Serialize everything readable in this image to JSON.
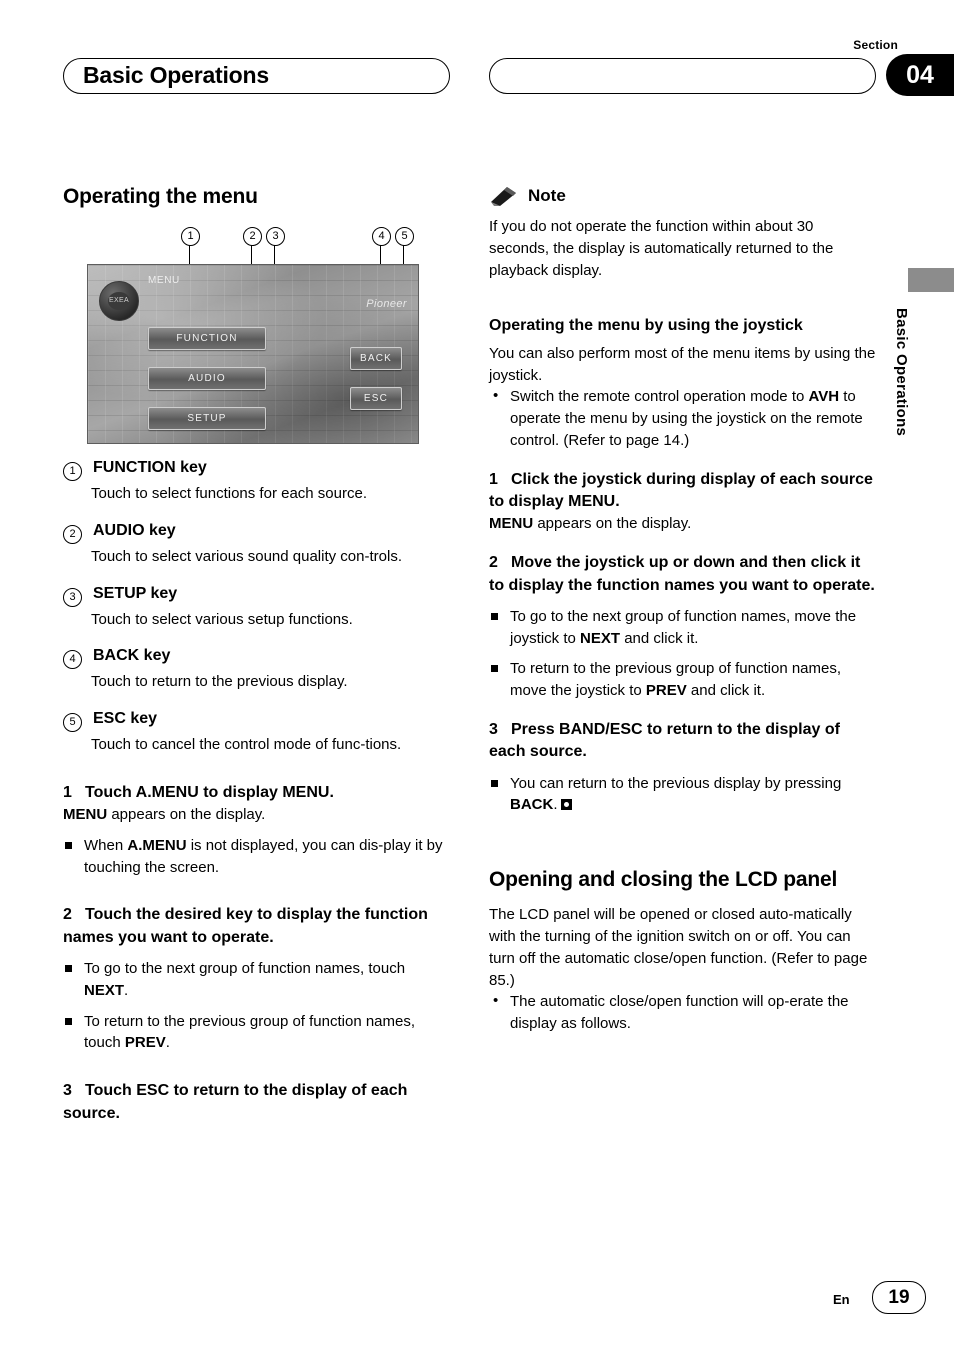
{
  "header": {
    "section_label": "Section",
    "section_number": "04",
    "title": "Basic Operations"
  },
  "side_tab": {
    "label": "Basic Operations"
  },
  "left": {
    "section_title": "Operating the menu",
    "figure": {
      "callouts": [
        "1",
        "2",
        "3",
        "4",
        "5"
      ],
      "device": {
        "knob_label": "EXEA",
        "menu_tag": "MENU",
        "brand": "Pioneer",
        "buttons": [
          "FUNCTION",
          "AUDIO",
          "SETUP",
          "BACK",
          "ESC"
        ]
      }
    },
    "keys": [
      {
        "num": "1",
        "label": "FUNCTION key",
        "desc": "Touch to select functions for each source."
      },
      {
        "num": "2",
        "label": "AUDIO key",
        "desc": "Touch to select various sound quality con-trols."
      },
      {
        "num": "3",
        "label": "SETUP key",
        "desc": "Touch to select various setup functions."
      },
      {
        "num": "4",
        "label": "BACK key",
        "desc": "Touch to return to the previous display."
      },
      {
        "num": "5",
        "label": "ESC key",
        "desc": "Touch to cancel the control mode of func-tions."
      }
    ],
    "step1": {
      "num": "1",
      "head": "Touch A.MENU to display MENU.",
      "line_bold": "MENU",
      "line_rest": " appears on the display.",
      "bullet_a": "When ",
      "bullet_a_bold": "A.MENU",
      "bullet_a_rest": " is not displayed, you can dis-play it by touching the screen."
    },
    "step2": {
      "num": "2",
      "head": "Touch the desired key to display the function names you want to operate.",
      "bullet1_pre": "To go to the next group of function names, touch ",
      "bullet1_bold": "NEXT",
      "bullet1_post": ".",
      "bullet2_pre": "To return to the previous group of function names, touch ",
      "bullet2_bold": "PREV",
      "bullet2_post": "."
    },
    "step3": {
      "num": "3",
      "head": "Touch ESC to return to the display of each source."
    }
  },
  "right": {
    "note": {
      "label": "Note",
      "body": "If you do not operate the function within about 30 seconds, the display is automatically returned to the playback display."
    },
    "joystick": {
      "title": "Operating the menu by using the joystick",
      "intro": "You can also perform most of the menu items by using the joystick.",
      "bullet_pre": "Switch the remote control operation mode to ",
      "bullet_bold": "AVH",
      "bullet_post": " to operate the menu by using the joystick on the remote control. (Refer to page 14.)",
      "step1": {
        "num": "1",
        "head": "Click the joystick during display of each source to display MENU.",
        "line_bold": "MENU",
        "line_rest": " appears on the display."
      },
      "step2": {
        "num": "2",
        "head": "Move the joystick up or down and then click it to display the function names you want to operate.",
        "bullet1_pre": "To go to the next group of function names, move the joystick to ",
        "bullet1_bold": "NEXT",
        "bullet1_post": " and click it.",
        "bullet2_pre": "To return to the previous group of function names, move the joystick to ",
        "bullet2_bold": "PREV",
        "bullet2_post": " and click it."
      },
      "step3": {
        "num": "3",
        "head": "Press BAND/ESC to return to the display of each source.",
        "bullet_pre": "You can return to the previous display by pressing ",
        "bullet_bold": "BACK",
        "bullet_post": "."
      }
    },
    "lcd": {
      "title": "Opening and closing the LCD panel",
      "body": "The LCD panel will be opened or closed auto-matically with the turning of the ignition switch on or off. You can turn off the automatic close/open function. (Refer to page 85.)",
      "bullet": "The automatic close/open function will op-erate the display as follows."
    }
  },
  "footer": {
    "lang": "En",
    "page": "19"
  }
}
